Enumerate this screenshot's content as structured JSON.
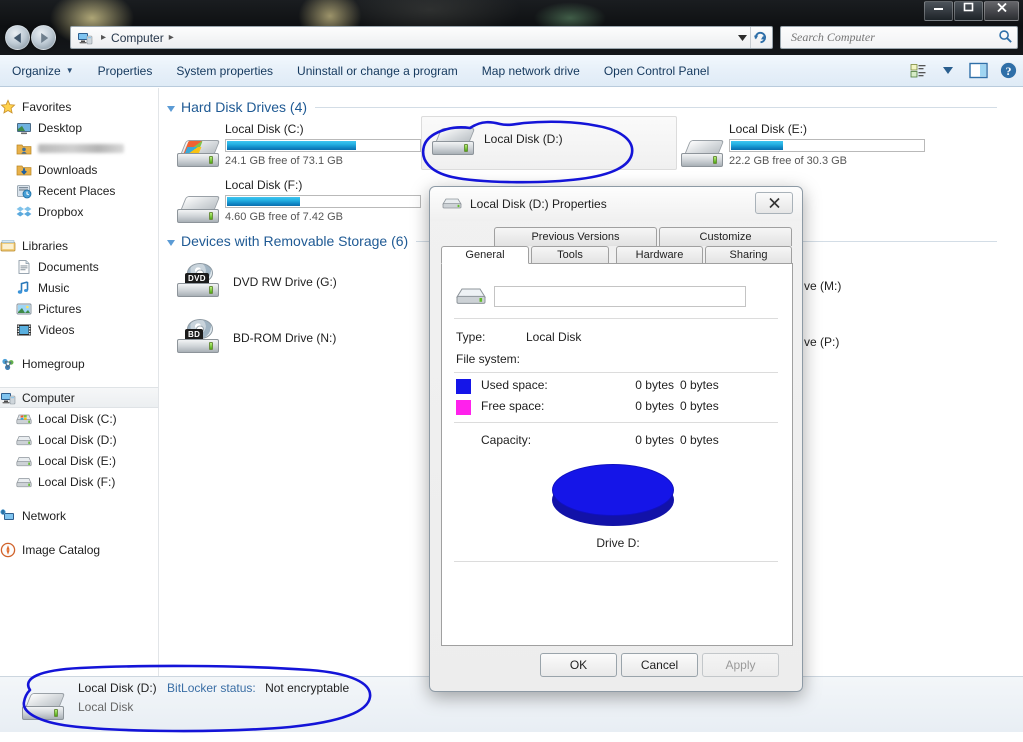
{
  "window": {
    "title_icon": "computer-icon",
    "minimize_label": "Minimize",
    "maximize_label": "Maximize",
    "close_label": "Close"
  },
  "address_bar": {
    "crumb": "Computer",
    "separator": "▸",
    "dropdown_icon": "chevron-down-icon",
    "refresh_icon": "refresh-icon"
  },
  "search": {
    "placeholder": "Search Computer",
    "value": "",
    "icon": "search-icon"
  },
  "command_bar": {
    "items": [
      {
        "label": "Organize",
        "has_caret": true
      },
      {
        "label": "Properties",
        "has_caret": false
      },
      {
        "label": "System properties",
        "has_caret": false
      },
      {
        "label": "Uninstall or change a program",
        "has_caret": false
      },
      {
        "label": "Map network drive",
        "has_caret": false
      },
      {
        "label": "Open Control Panel",
        "has_caret": false
      }
    ],
    "view_icon": "view-list-icon",
    "view_caret_icon": "chevron-down-icon",
    "preview_pane_icon": "preview-pane-icon",
    "help_icon": "help-icon"
  },
  "sidebar": {
    "items": [
      {
        "label": "Favorites",
        "icon": "star-icon",
        "level": 0
      },
      {
        "label": "Desktop",
        "icon": "desktop-icon",
        "level": 1
      },
      {
        "label": "",
        "icon": "user-folder-icon",
        "level": 1,
        "redacted": true
      },
      {
        "label": "Downloads",
        "icon": "downloads-folder-icon",
        "level": 1
      },
      {
        "label": "Recent Places",
        "icon": "recent-places-icon",
        "level": 1
      },
      {
        "label": "Dropbox",
        "icon": "dropbox-icon",
        "level": 1
      },
      {
        "label": "GAP",
        "icon": "",
        "level": -1
      },
      {
        "label": "Libraries",
        "icon": "libraries-icon",
        "level": 0
      },
      {
        "label": "Documents",
        "icon": "documents-icon",
        "level": 1
      },
      {
        "label": "Music",
        "icon": "music-icon",
        "level": 1
      },
      {
        "label": "Pictures",
        "icon": "pictures-icon",
        "level": 1
      },
      {
        "label": "Videos",
        "icon": "videos-icon",
        "level": 1
      },
      {
        "label": "GAP",
        "icon": "",
        "level": -1
      },
      {
        "label": "Homegroup",
        "icon": "homegroup-icon",
        "level": 0
      },
      {
        "label": "GAP",
        "icon": "",
        "level": -1
      },
      {
        "label": "Computer",
        "icon": "computer-icon",
        "level": 0,
        "selected": true
      },
      {
        "label": "Local Disk (C:)",
        "icon": "hdd-windows-icon",
        "level": 1
      },
      {
        "label": "Local Disk (D:)",
        "icon": "hdd-icon",
        "level": 1
      },
      {
        "label": "Local Disk (E:)",
        "icon": "hdd-icon",
        "level": 1
      },
      {
        "label": "Local Disk (F:)",
        "icon": "hdd-icon",
        "level": 1
      },
      {
        "label": "GAP",
        "icon": "",
        "level": -1
      },
      {
        "label": "Network",
        "icon": "network-icon",
        "level": 0
      },
      {
        "label": "GAP",
        "icon": "",
        "level": -1
      },
      {
        "label": "Image Catalog",
        "icon": "image-catalog-icon",
        "level": 0
      }
    ]
  },
  "content": {
    "groups": [
      {
        "title": "Hard Disk Drives (4)"
      },
      {
        "title": "Devices with Removable Storage (6)"
      }
    ],
    "drives": [
      {
        "name": "Local Disk (C:)",
        "free_text": "24.1 GB free of 73.1 GB",
        "used_percent": 67,
        "icon": "hdd-windows-icon",
        "has_bar": true,
        "selected": false
      },
      {
        "name": "Local Disk (D:)",
        "free_text": "",
        "used_percent": 0,
        "icon": "hdd-icon",
        "has_bar": false,
        "selected": true
      },
      {
        "name": "Local Disk (E:)",
        "free_text": "22.2 GB free of 30.3 GB",
        "used_percent": 27,
        "icon": "hdd-icon",
        "has_bar": true,
        "selected": false
      },
      {
        "name": "Local Disk (F:)",
        "free_text": "4.60 GB free of 7.42 GB",
        "used_percent": 38,
        "icon": "hdd-icon",
        "has_bar": true,
        "selected": false
      }
    ],
    "removable": [
      {
        "name": "DVD RW Drive (G:)",
        "badge": "DVD",
        "icon": "optical-drive-icon"
      },
      {
        "name": "BD-ROM Drive (N:)",
        "badge": "BD",
        "icon": "optical-drive-icon"
      }
    ],
    "occluded": [
      {
        "name": "ve (M:)"
      },
      {
        "name": "ve (P:)"
      }
    ]
  },
  "dialog": {
    "title": "Local Disk (D:) Properties",
    "title_icon": "hdd-icon",
    "close_label": "✖",
    "tabs_row1": [
      {
        "label": "Previous Versions"
      },
      {
        "label": "Customize"
      }
    ],
    "tabs_row2": [
      {
        "label": "General",
        "active": true
      },
      {
        "label": "Tools",
        "active": false
      },
      {
        "label": "Hardware",
        "active": false
      },
      {
        "label": "Sharing",
        "active": false
      }
    ],
    "volume_label_value": "",
    "fields": [
      {
        "label": "Type:",
        "value": "Local Disk"
      },
      {
        "label": "File system:",
        "value": ""
      }
    ],
    "legend": [
      {
        "label": "Used space:",
        "color": "#1515e8",
        "value1": "0 bytes",
        "value2": "0 bytes"
      },
      {
        "label": "Free space:",
        "color": "#ff21ec",
        "value1": "0 bytes",
        "value2": "0 bytes"
      }
    ],
    "capacity": {
      "label": "Capacity:",
      "value1": "0 bytes",
      "value2": "0 bytes"
    },
    "pie_label": "Drive D:",
    "buttons": [
      {
        "label": "OK",
        "disabled": false
      },
      {
        "label": "Cancel",
        "disabled": false
      },
      {
        "label": "Apply",
        "disabled": true
      }
    ]
  },
  "chart_data": {
    "type": "pie",
    "title": "Drive D:",
    "categories": [
      "Used space",
      "Free space"
    ],
    "values": [
      0,
      0
    ],
    "value_labels": [
      "0 bytes",
      "0 bytes"
    ],
    "colors": [
      "#1515e8",
      "#ff21ec"
    ],
    "legend_position": "above",
    "note": "Disk shows 0 bytes for all figures; rendered as a single solid blue 3-D disc."
  },
  "status_bar": {
    "icon": "hdd-icon",
    "name": "Local Disk (D:)",
    "bitlocker_key": "BitLocker status:",
    "bitlocker_value": "Not encryptable",
    "type": "Local Disk"
  },
  "annotations": {
    "circle_drive_tile": "hand-drawn-blue-circle-around-local-disk-d-tile",
    "circle_status_bar": "hand-drawn-blue-circle-around-status-bar-entry",
    "ink_color": "#1414d8"
  }
}
